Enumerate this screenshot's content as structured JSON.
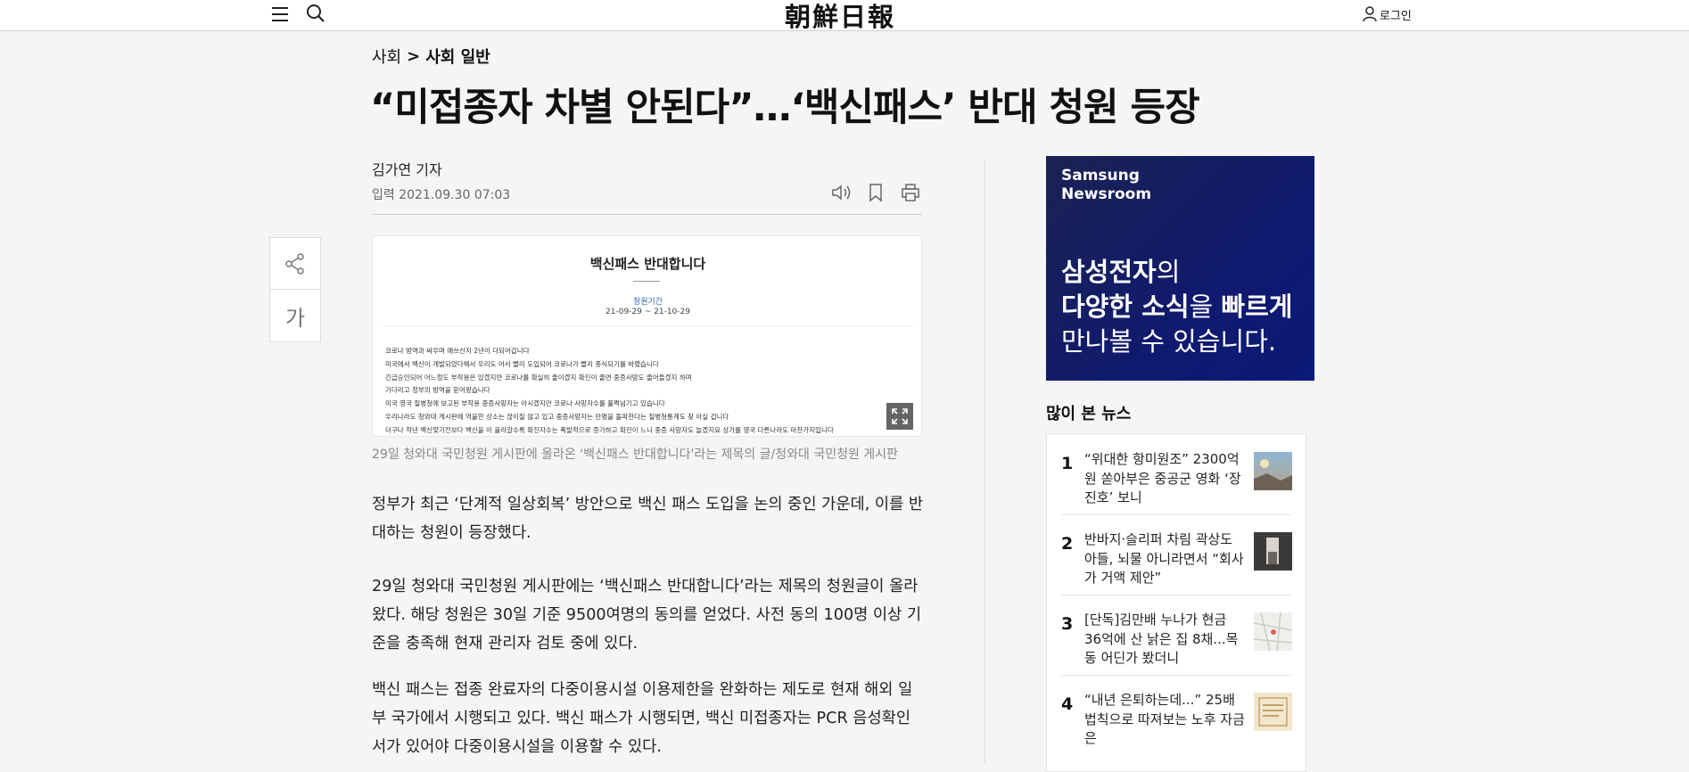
{
  "header": {
    "logo": "朝鮮日報",
    "login_label": "로그인"
  },
  "breadcrumb": {
    "section": "사회",
    "separator": ">",
    "subsection": "사회 일반"
  },
  "article": {
    "headline": "“미접종자 차별 안된다”…‘백신패스’ 반대 청원 등장",
    "byline": "김가연 기자",
    "dateline": "입력 2021.09.30 07:03",
    "photo": {
      "title": "백신패스 반대합니다",
      "period_label": "청원기간",
      "period": "21-09-29 ~ 21-10-29",
      "body_lines": [
        "코로나 방역과 싸우며 애쓰신지 2년이 다되어갑니다",
        "미국에서 백신이 개발되었다해서 우리도 어서 빨리 도입되어 코로나가 빨리 종식되기를 바랬습니다",
        "긴급승인되어 어느정도 부작용은 있겠지만 코로나를 확실히 줄이겠지 확진이 줄면 중증사망도 줄어들겠지 하며",
        "기다리고 정부의 방역을 믿어왔습니다",
        "미국 영국 질병청에 보고된 부작용 중증사망자는 아시겠지만 코로나 사망자수를 훌쩍넘기고 있습니다",
        "우리나라도 청와대 게시판에 억울한 상소는 끊이질 않고 있고 중증사망자는 만명을 돌파한다는 질병청통계도 찾 아실 겁니다",
        "더구나 작년 백신맞기전보다 백신을 이 올라갈수록 확진자수는 폭발적으로 증가하고 확진이 느니 중증 사망자도 늘겠지요 상가를 영국 다른나라도 마찬가지입니다"
      ],
      "caption": "29일 청와대 국민청원 게시판에 올라온 '백신패스 반대합니다'라는 제목의 글/청와대 국민청원 게시판"
    },
    "paragraphs": [
      "정부가 최근 ‘단계적 일상회복’ 방안으로 백신 패스 도입을 논의 중인 가운데, 이를 반대하는 청원이 등장했다.",
      "29일 청와대 국민청원 게시판에는 ‘백신패스 반대합니다’라는 제목의 청원글이 올라왔다. 해당 청원은 30일 기준 9500여명의 동의를 얻었다. 사전 동의 100명 이상 기준을 충족해 현재 관리자 검토 중에 있다.",
      "백신 패스는 접종 완료자의 다중이용시설 이용제한을 완화하는 제도로 현재 해외 일부 국가에서 시행되고 있다. 백신 패스가 시행되면, 백신 미접종자는 PCR 음성확인서가 있어야 다중이용시설을 이용할 수 있다."
    ]
  },
  "side_tools": {
    "font_size_label": "가"
  },
  "ad": {
    "brand_line1": "Samsung",
    "brand_line2": "Newsroom",
    "line1_bold": "삼성전자",
    "line1_rest": "의",
    "line2_bold1": "다양한 소식",
    "line2_mid": "을 ",
    "line2_bold2": "빠르게",
    "line3": "만나볼 수 있습니다."
  },
  "popular": {
    "title": "많이 본 뉴스",
    "items": [
      {
        "rank": "1",
        "text": "“위대한 항미원조” 2300억원 쏟아부은 중공군 영화 ‘장진호’ 보니"
      },
      {
        "rank": "2",
        "text": "반바지·슬리퍼 차림 곽상도 아들, 뇌물 아니라면서 “회사가 거액 제안”"
      },
      {
        "rank": "3",
        "text": "[단독]김만배 누나가 현금 36억에 산 낡은 집 8채...목동 어딘가 봤더니"
      },
      {
        "rank": "4",
        "text": "“내년 은퇴하는데...” 25배 법칙으로 따져보는 노후 자금은"
      }
    ]
  },
  "colors": {
    "ad_background": "#101a6e",
    "petition_label": "#2a67b3",
    "page_background": "#f5f5f5"
  },
  "icons": [
    "menu-icon",
    "search-icon",
    "user-icon",
    "speaker-icon",
    "bookmark-icon",
    "print-icon",
    "share-icon",
    "expand-icon"
  ]
}
